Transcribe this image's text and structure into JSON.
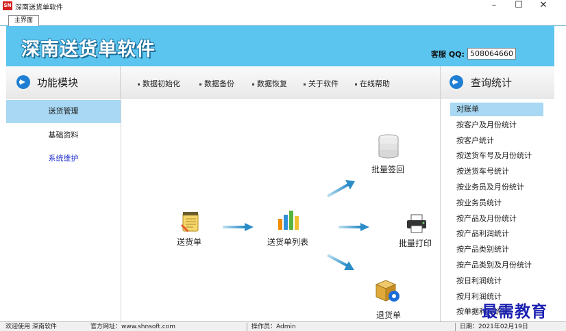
{
  "window": {
    "app_icon_text": "SN",
    "title": "深南送货单软件",
    "minimize": "–",
    "maximize": "☐",
    "close": "✕"
  },
  "tabs": [
    {
      "label": "主界面"
    }
  ],
  "banner": {
    "title": "深南送货单软件",
    "qq_label": "客服 QQ:",
    "qq_value": "508064660",
    "color": "#5bc4ef"
  },
  "left_panel": {
    "header": "功能模块",
    "items": [
      {
        "label": "送货管理",
        "state": "active"
      },
      {
        "label": "基础资料",
        "state": "normal"
      },
      {
        "label": "系统维护",
        "state": "link"
      }
    ]
  },
  "toolbar": {
    "items": [
      {
        "label": "数据初始化"
      },
      {
        "label": "数据备份"
      },
      {
        "label": "数据恢复"
      },
      {
        "label": "关于软件"
      },
      {
        "label": "在线帮助"
      }
    ]
  },
  "flow": {
    "delivery_note": "送货单",
    "delivery_list": "送货单列表",
    "batch_return": "批量签回",
    "batch_print": "批量打印",
    "return_note": "退货单"
  },
  "right_panel": {
    "header": "查询统计",
    "items": [
      {
        "label": "对账单",
        "selected": true
      },
      {
        "label": "按客户及月份统计"
      },
      {
        "label": "按客户统计"
      },
      {
        "label": "按送货车号及月份统计"
      },
      {
        "label": "按送货车号统计"
      },
      {
        "label": "按业务员及月份统计"
      },
      {
        "label": "按业务员统计"
      },
      {
        "label": "按产品及月份统计"
      },
      {
        "label": "按产品利润统计"
      },
      {
        "label": "按产品类别统计"
      },
      {
        "label": "按产品类别及月份统计"
      },
      {
        "label": "按日利润统计"
      },
      {
        "label": "按月利润统计"
      },
      {
        "label": "按单据利润统计"
      }
    ]
  },
  "statusbar": {
    "welcome": "欢迎使用 深南软件",
    "website": "官方网址：www.shnsoft.com",
    "operator": "操作员：Admin",
    "date": "日期：2021年02月19日"
  },
  "watermark": "最需教育",
  "colors": {
    "accent": "#1f7fd4",
    "selection": "#a8d8f3",
    "arrow": "#3a9bd1"
  }
}
